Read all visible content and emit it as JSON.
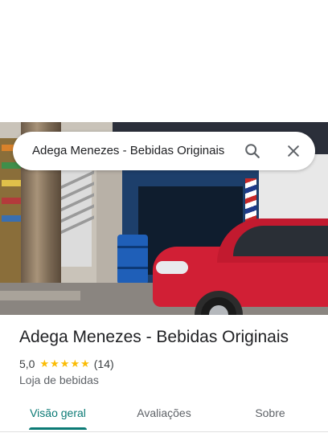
{
  "search": {
    "query": "Adega Menezes - Bebidas Originais",
    "search_icon": "search-icon",
    "close_icon": "close-icon"
  },
  "place": {
    "name": "Adega Menezes - Bebidas Originais",
    "rating": "5,0",
    "stars": 5,
    "review_count": "(14)",
    "category": "Loja de bebidas"
  },
  "tabs": [
    {
      "label": "Visão geral",
      "active": true
    },
    {
      "label": "Avaliações",
      "active": false
    },
    {
      "label": "Sobre",
      "active": false
    }
  ],
  "colors": {
    "accent": "#0b7a75",
    "star": "#fbbc04"
  }
}
